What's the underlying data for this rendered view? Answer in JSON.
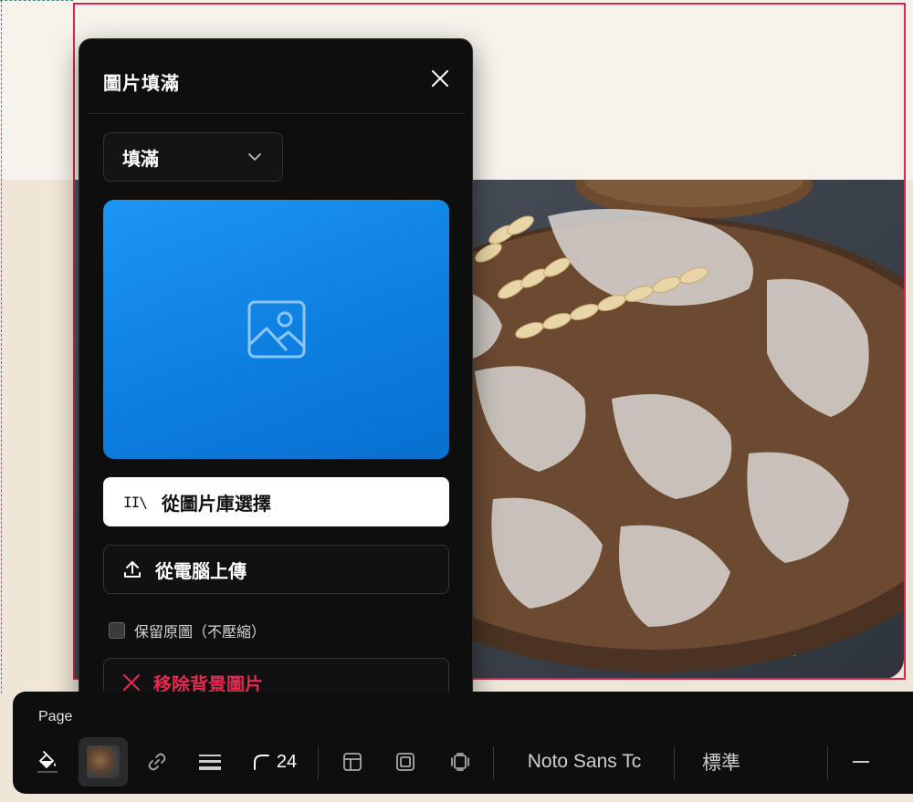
{
  "panel": {
    "title": "圖片填滿",
    "fill_mode": "填滿",
    "library_button": "從圖片庫選擇",
    "library_icon_text": "II\\",
    "upload_button": "從電腦上傳",
    "keep_original_label": "保留原圖（不壓縮）",
    "keep_original_checked": false,
    "remove_button": "移除背景圖片"
  },
  "toolbar": {
    "page_label": "Page",
    "corner_radius": "24",
    "font_family": "Noto Sans Tc",
    "font_weight": "標準",
    "icons": [
      "fill-bucket-icon",
      "link-icon",
      "menu-lines-icon",
      "corner-radius-icon",
      "layout-icon",
      "frame-icon",
      "align-icon",
      "minus-icon"
    ]
  },
  "colors": {
    "panel_bg": "#0e0e0f",
    "accent_blue": "#0d7fe0",
    "danger": "#e8294f",
    "selection": "#d7264f"
  }
}
